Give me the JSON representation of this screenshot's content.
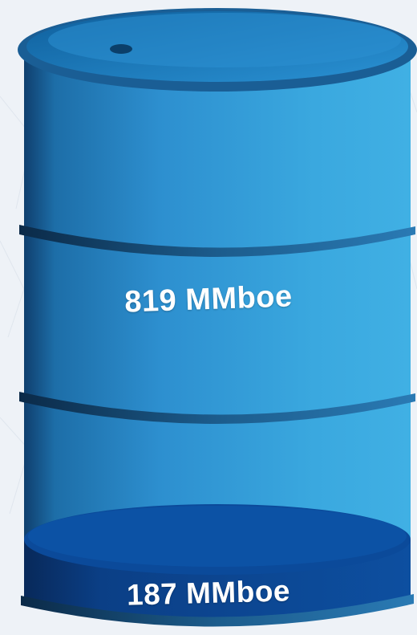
{
  "barrel": {
    "upper_volume_label": "819 MMboe",
    "lower_volume_label": "187 MMboe",
    "colors": {
      "body_light": "#3aa8df",
      "body_dark": "#0d4f86",
      "fill_dark": "#0a3f86",
      "fill_surface": "#0c57a8",
      "rim": "#1f5f8e",
      "background": "#eef2f7"
    }
  }
}
